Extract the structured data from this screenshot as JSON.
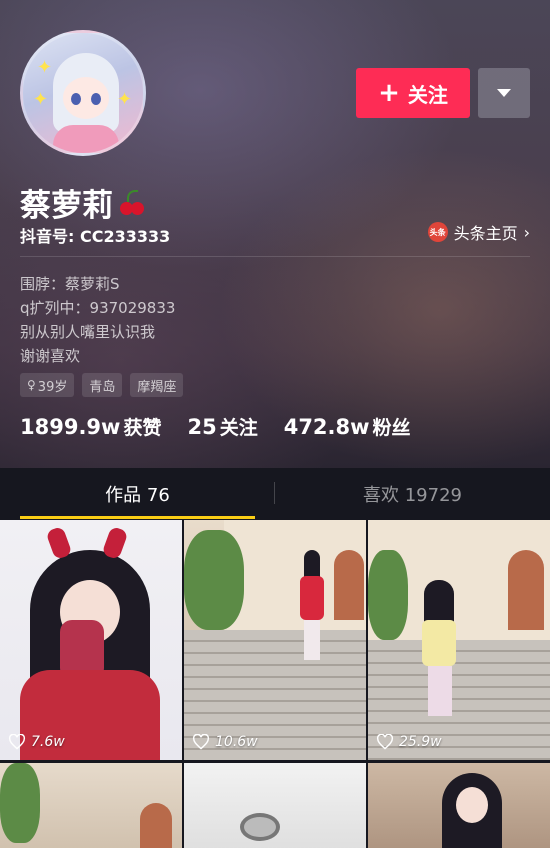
{
  "profile": {
    "name": "蔡萝莉",
    "name_emoji": "cherry-icon",
    "douyin_id": "抖音号: CC233333",
    "follow_label": "关注",
    "toutiao_logo": "头条",
    "toutiao_label": "头条主页",
    "bio": [
      "围脖：蔡萝莉S",
      "q扩列中：937029833",
      "别从别人嘴里认识我",
      "谢谢喜欢"
    ],
    "tags": [
      "39岁",
      "青岛",
      "摩羯座"
    ],
    "stats": [
      {
        "num": "1899.9w",
        "label": "获赞"
      },
      {
        "num": "25",
        "label": "关注"
      },
      {
        "num": "472.8w",
        "label": "粉丝"
      }
    ]
  },
  "tabs": [
    {
      "label": "作品 76",
      "active": true
    },
    {
      "label": "喜欢 19729",
      "active": false
    }
  ],
  "videos": [
    {
      "likes": "7.6w"
    },
    {
      "likes": "10.6w"
    },
    {
      "likes": "25.9w"
    }
  ],
  "colors": {
    "accent": "#fe2c55",
    "tab_underline": "#face15",
    "background": "#16171f"
  }
}
